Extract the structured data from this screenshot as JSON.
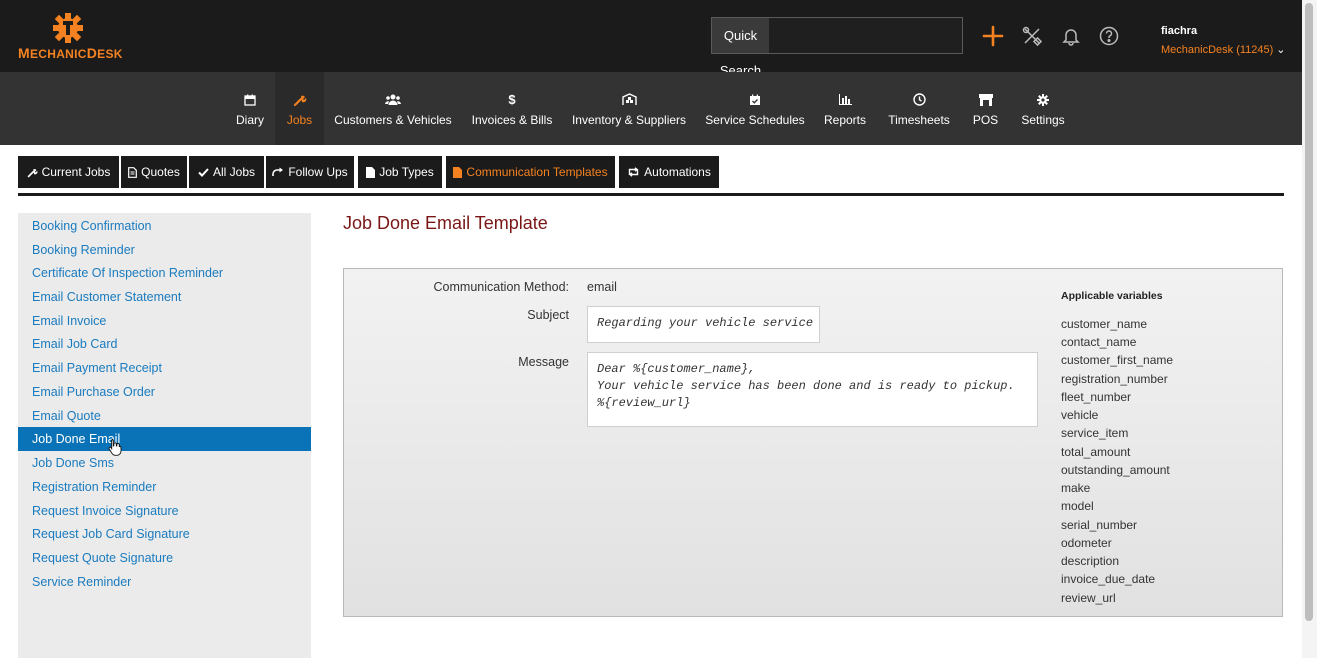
{
  "brand": {
    "logo_text_first": "M",
    "logo_text_rest": "ECHANIC",
    "logo_text_d": "D",
    "logo_text_end": "ESK"
  },
  "header": {
    "quick_search_label": "Quick Search",
    "quick_search_value": "",
    "user_name": "fiachra",
    "user_org": "MechanicDesk (11245)"
  },
  "nav": {
    "items": [
      {
        "label": "Diary",
        "icon": "calendar-icon"
      },
      {
        "label": "Jobs",
        "icon": "wrench-icon"
      },
      {
        "label": "Customers & Vehicles",
        "icon": "users-icon"
      },
      {
        "label": "Invoices & Bills",
        "icon": "dollar-icon"
      },
      {
        "label": "Inventory & Suppliers",
        "icon": "warehouse-icon"
      },
      {
        "label": "Service Schedules",
        "icon": "calendar-check-icon"
      },
      {
        "label": "Reports",
        "icon": "bar-chart-icon"
      },
      {
        "label": "Timesheets",
        "icon": "clock-icon"
      },
      {
        "label": "POS",
        "icon": "store-icon"
      },
      {
        "label": "Settings",
        "icon": "gear-icon"
      }
    ],
    "active": "Jobs"
  },
  "subtabs": {
    "items": [
      {
        "label": "Current Jobs"
      },
      {
        "label": "Quotes"
      },
      {
        "label": "All Jobs"
      },
      {
        "label": "Follow Ups"
      },
      {
        "label": "Job Types"
      },
      {
        "label": "Communication Templates"
      },
      {
        "label": "Automations"
      }
    ],
    "active": "Communication Templates"
  },
  "sidebar": {
    "items": [
      {
        "label": "Booking Confirmation"
      },
      {
        "label": "Booking Reminder"
      },
      {
        "label": "Certificate Of Inspection Reminder"
      },
      {
        "label": "Email Customer Statement"
      },
      {
        "label": "Email Invoice"
      },
      {
        "label": "Email Job Card"
      },
      {
        "label": "Email Payment Receipt"
      },
      {
        "label": "Email Purchase Order"
      },
      {
        "label": "Email Quote"
      },
      {
        "label": "Job Done Email"
      },
      {
        "label": "Job Done Sms"
      },
      {
        "label": "Registration Reminder"
      },
      {
        "label": "Request Invoice Signature"
      },
      {
        "label": "Request Job Card Signature"
      },
      {
        "label": "Request Quote Signature"
      },
      {
        "label": "Service Reminder"
      }
    ],
    "active": "Job Done Email"
  },
  "template": {
    "title": "Job Done Email Template",
    "method_label": "Communication Method:",
    "method_value": "email",
    "subject_label": "Subject",
    "subject_value": "Regarding your vehicle service",
    "message_label": "Message",
    "message_value": "Dear %{customer_name},\nYour vehicle service has been done and is ready to pickup.\n%{review_url}",
    "variables_title": "Applicable variables",
    "variables": [
      "customer_name",
      "contact_name",
      "customer_first_name",
      "registration_number",
      "fleet_number",
      "vehicle",
      "service_item",
      "total_amount",
      "outstanding_amount",
      "make",
      "model",
      "serial_number",
      "odometer",
      "description",
      "invoice_due_date",
      "review_url"
    ]
  },
  "colors": {
    "accent": "#f58220",
    "link": "#1a7bbf",
    "active_bg": "#0a73b7",
    "title": "#7a1616",
    "topbar": "#1b1b1b",
    "nav": "#333333"
  }
}
